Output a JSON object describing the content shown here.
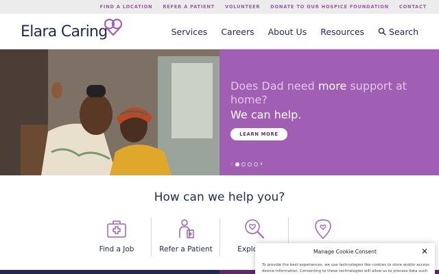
{
  "utility_bar": {
    "links": [
      "FIND A LOCATION",
      "REFER A PATIENT",
      "VOLUNTEER",
      "DONATE TO OUR HOSPICE FOUNDATION",
      "CONTACT"
    ]
  },
  "header": {
    "logo_text": "Elara Caring",
    "nav": [
      "Services",
      "Careers",
      "About Us",
      "Resources"
    ],
    "search_label": "Search"
  },
  "hero": {
    "question_part1": "Does Dad need ",
    "question_emphasis": "more",
    "question_part2": " support at home?",
    "answer": "We can help.",
    "cta_label": "LEARN MORE",
    "carousel": {
      "slide_count": 4,
      "active_index": 0
    }
  },
  "help": {
    "title": "How can we help you?",
    "items": [
      {
        "label": "Find a Job",
        "icon": "medical-kit-icon"
      },
      {
        "label": "Refer a Patient",
        "icon": "caregiver-icon"
      },
      {
        "label": "Explore S",
        "icon": "magnifier-heart-icon"
      },
      {
        "label": "",
        "icon": "location-heart-icon"
      }
    ]
  },
  "cookie": {
    "title": "Manage Cookie Consent",
    "text": "To provide the best experiences, we use technologies like cookies to store and/or access device information. Consenting to these technologies will allow us to process data such"
  },
  "colors": {
    "brand_purple": "#a15fb4",
    "navy": "#1f2a4d",
    "utility_link": "#9b5aa6",
    "utility_bg": "#ececec"
  }
}
